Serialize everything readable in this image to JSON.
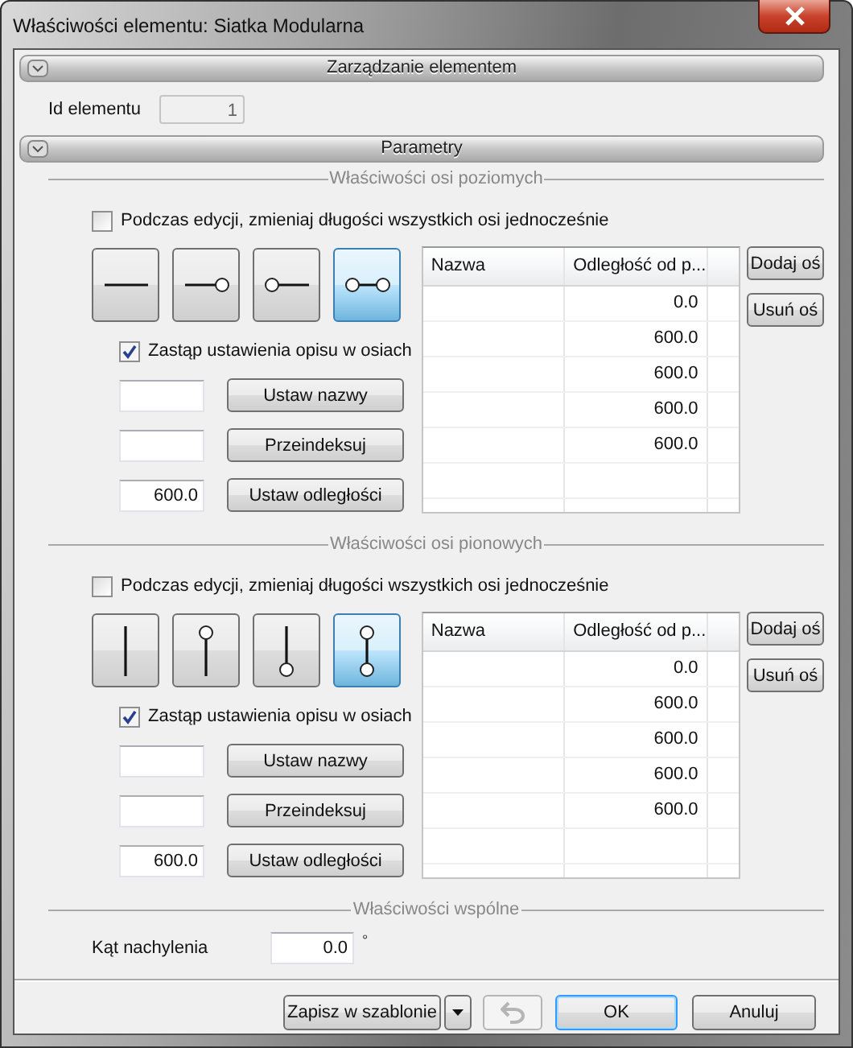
{
  "window": {
    "title": "Właściwości elementu: Siatka Modularna"
  },
  "element_management": {
    "header": "Zarządzanie elementem",
    "id_label": "Id elementu",
    "id_value": "1"
  },
  "parameters": {
    "header": "Parametry"
  },
  "axis_groups": [
    {
      "kind": "horizontal",
      "title": "Właściwości osi poziomych",
      "simultaneous": {
        "label": "Podczas edycji, zmieniaj długości wszystkich osi jednocześnie",
        "checked": false
      },
      "styles": [
        {
          "kind": "plain",
          "selected": false
        },
        {
          "kind": "end",
          "selected": false
        },
        {
          "kind": "start",
          "selected": false
        },
        {
          "kind": "both",
          "selected": true
        }
      ],
      "override": {
        "label": "Zastąp ustawienia opisu w osiach",
        "checked": true
      },
      "actions": [
        {
          "button": "Ustaw nazwy"
        },
        {
          "button": "Przeindeksuj"
        },
        {
          "value": "600.0",
          "button": "Ustaw odległości"
        }
      ],
      "table": {
        "columns": [
          "Nazwa",
          "Odległość od p..."
        ],
        "rows": [
          {
            "distance": "0.0"
          },
          {
            "distance": "600.0"
          },
          {
            "distance": "600.0"
          },
          {
            "distance": "600.0"
          },
          {
            "distance": "600.0"
          }
        ]
      },
      "side_buttons": [
        "Dodaj oś",
        "Usuń oś"
      ]
    },
    {
      "kind": "vertical",
      "title": "Właściwości osi pionowych",
      "simultaneous": {
        "label": "Podczas edycji, zmieniaj długości wszystkich osi jednocześnie",
        "checked": false
      },
      "styles": [
        {
          "kind": "plain",
          "selected": false
        },
        {
          "kind": "end",
          "selected": false
        },
        {
          "kind": "start",
          "selected": false
        },
        {
          "kind": "both",
          "selected": true
        }
      ],
      "override": {
        "label": "Zastąp ustawienia opisu w osiach",
        "checked": true
      },
      "actions": [
        {
          "button": "Ustaw nazwy"
        },
        {
          "button": "Przeindeksuj"
        },
        {
          "value": "600.0",
          "button": "Ustaw odległości"
        }
      ],
      "table": {
        "columns": [
          "Nazwa",
          "Odległość od p..."
        ],
        "rows": [
          {
            "distance": "0.0"
          },
          {
            "distance": "600.0"
          },
          {
            "distance": "600.0"
          },
          {
            "distance": "600.0"
          },
          {
            "distance": "600.0"
          }
        ]
      },
      "side_buttons": [
        "Dodaj oś",
        "Usuń oś"
      ]
    }
  ],
  "common": {
    "title": "Właściwości wspólne",
    "angle_label": "Kąt nachylenia",
    "angle_value": "0.0",
    "angle_unit": "°"
  },
  "footer": {
    "save_template": "Zapisz w szablonie",
    "undo": {
      "disabled": true
    },
    "ok": "OK",
    "cancel": "Anuluj"
  }
}
